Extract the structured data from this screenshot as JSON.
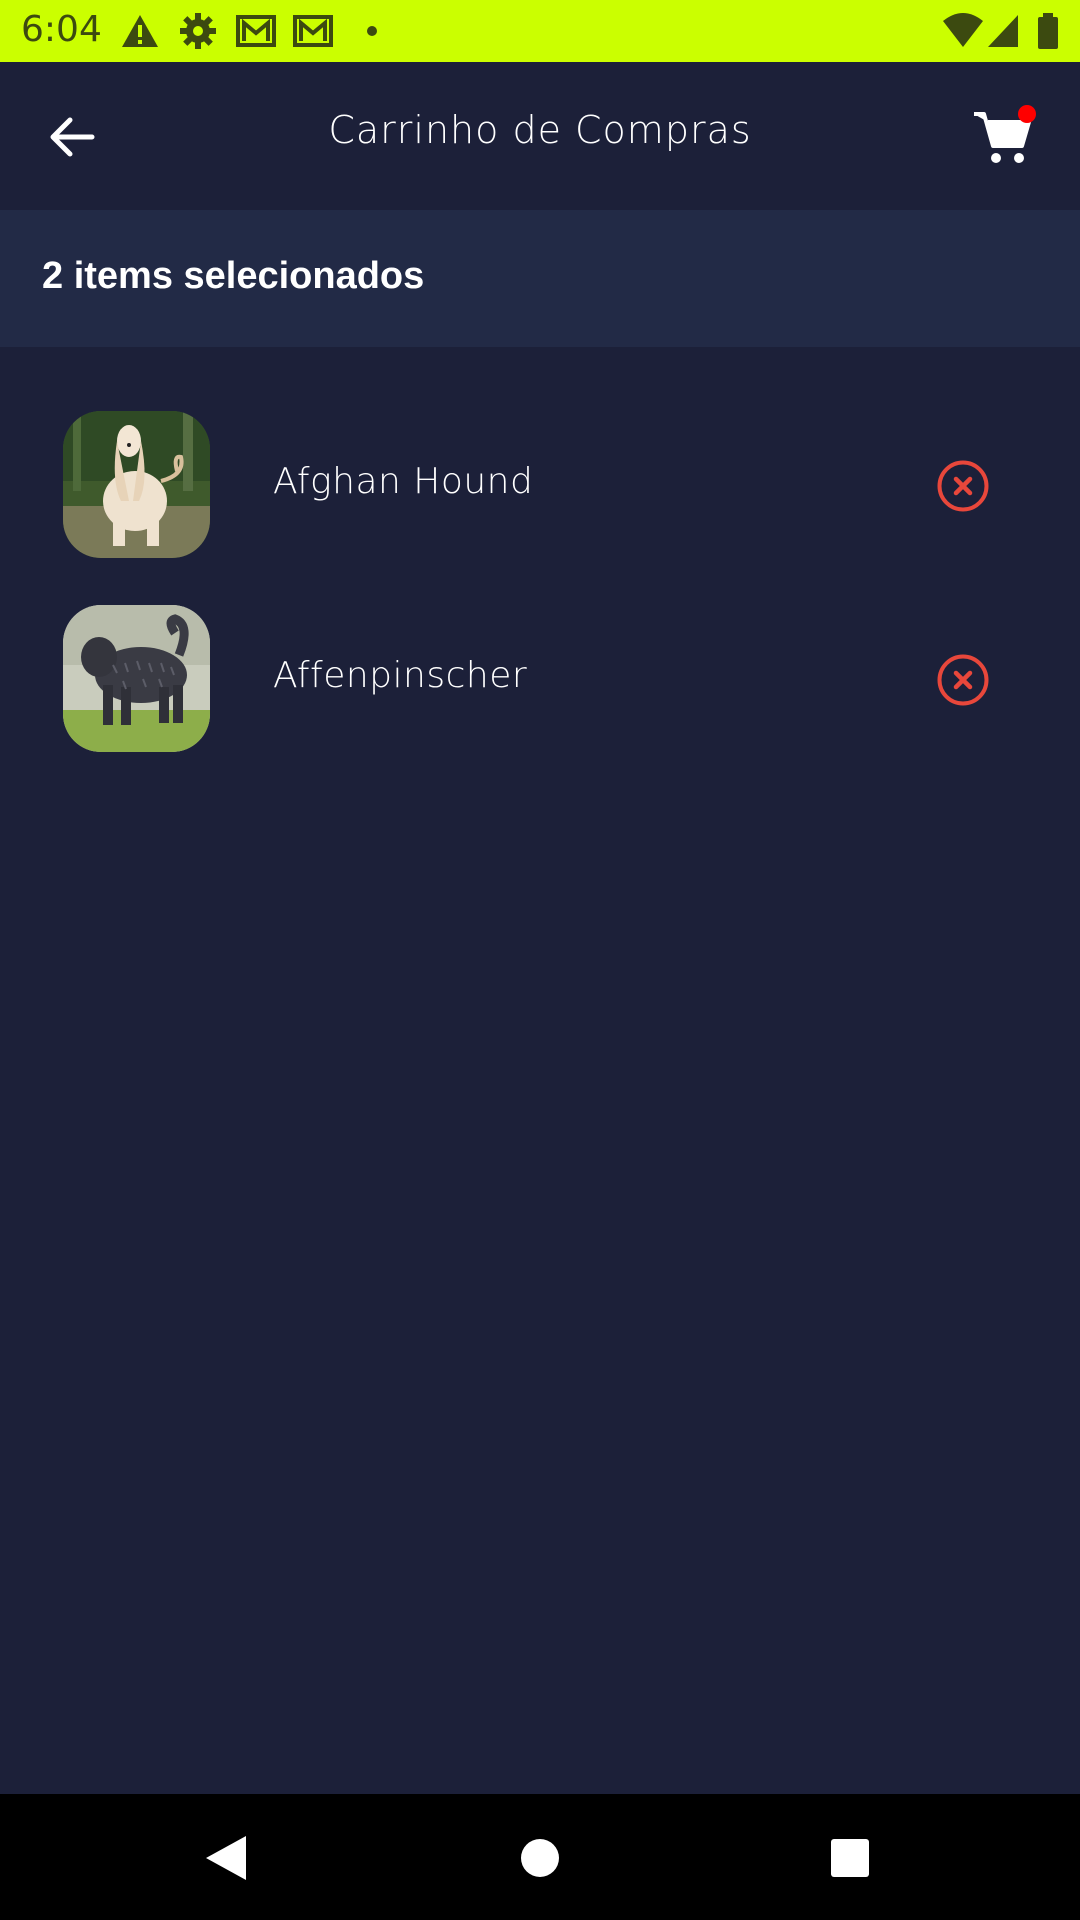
{
  "status_bar": {
    "time": "6:04",
    "background": "#cbff00",
    "icons": [
      "warning-icon",
      "gear-icon",
      "gmail-icon",
      "gmail-icon",
      "dot-icon",
      "wifi-icon",
      "signal-icon",
      "battery-icon"
    ]
  },
  "header": {
    "title": "Carrinho de Compras",
    "back_icon": "arrow-left-icon",
    "cart_icon": "shopping-cart-icon",
    "cart_badge_color": "#ff0000"
  },
  "selection": {
    "count_label": "2 items selecionados"
  },
  "cart": {
    "items": [
      {
        "name": "Afghan Hound",
        "remove_icon": "close-circle-icon"
      },
      {
        "name": "Affenpinscher",
        "remove_icon": "close-circle-icon"
      }
    ]
  },
  "colors": {
    "background": "#1c2039",
    "count_bar": "#222a46",
    "remove_accent": "#e8473b"
  },
  "nav": {
    "icons": [
      "back-triangle-icon",
      "home-circle-icon",
      "recents-square-icon"
    ]
  }
}
